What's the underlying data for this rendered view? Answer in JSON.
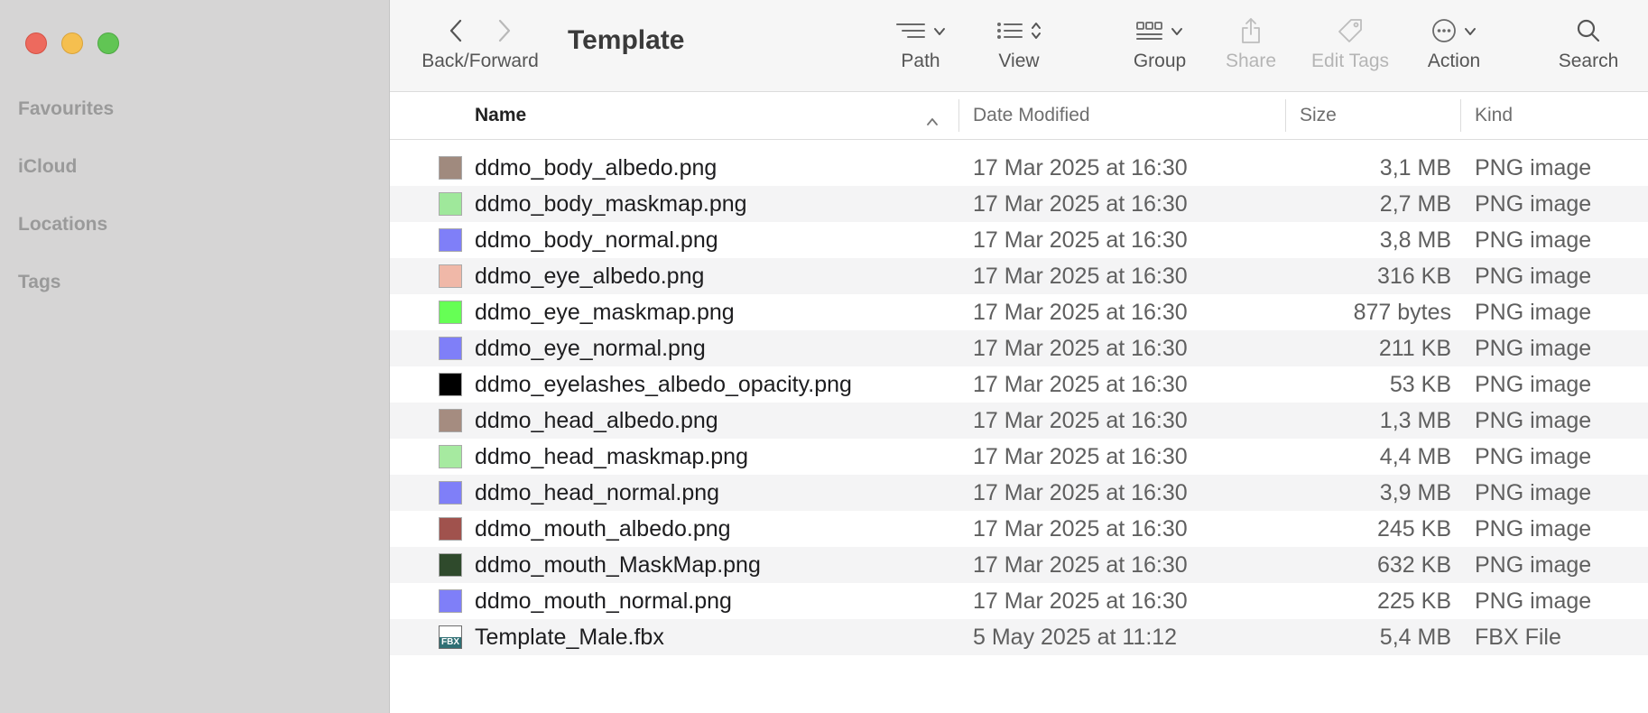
{
  "window": {
    "title": "Template"
  },
  "sidebar": {
    "sections": [
      "Favourites",
      "iCloud",
      "Locations",
      "Tags"
    ]
  },
  "toolbar": {
    "back_forward_label": "Back/Forward",
    "path_label": "Path",
    "view_label": "View",
    "group_label": "Group",
    "share_label": "Share",
    "edit_tags_label": "Edit Tags",
    "action_label": "Action",
    "search_label": "Search"
  },
  "columns": {
    "name": "Name",
    "date": "Date Modified",
    "size": "Size",
    "kind": "Kind"
  },
  "files": [
    {
      "name": "ddmo_body_albedo.png",
      "date": "17 Mar 2025 at 16:30",
      "size": "3,1 MB",
      "kind": "PNG image",
      "icon_color": "#a08a7e"
    },
    {
      "name": "ddmo_body_maskmap.png",
      "date": "17 Mar 2025 at 16:30",
      "size": "2,7 MB",
      "kind": "PNG image",
      "icon_color": "#9fe89b"
    },
    {
      "name": "ddmo_body_normal.png",
      "date": "17 Mar 2025 at 16:30",
      "size": "3,8 MB",
      "kind": "PNG image",
      "icon_color": "#7f7ff8"
    },
    {
      "name": "ddmo_eye_albedo.png",
      "date": "17 Mar 2025 at 16:30",
      "size": "316 KB",
      "kind": "PNG image",
      "icon_color": "#f0b8a8"
    },
    {
      "name": "ddmo_eye_maskmap.png",
      "date": "17 Mar 2025 at 16:30",
      "size": "877 bytes",
      "kind": "PNG image",
      "icon_color": "#66ff55"
    },
    {
      "name": "ddmo_eye_normal.png",
      "date": "17 Mar 2025 at 16:30",
      "size": "211 KB",
      "kind": "PNG image",
      "icon_color": "#7f7ff8"
    },
    {
      "name": "ddmo_eyelashes_albedo_opacity.png",
      "date": "17 Mar 2025 at 16:30",
      "size": "53 KB",
      "kind": "PNG image",
      "icon_color": "#000000"
    },
    {
      "name": "ddmo_head_albedo.png",
      "date": "17 Mar 2025 at 16:30",
      "size": "1,3 MB",
      "kind": "PNG image",
      "icon_color": "#a58c80"
    },
    {
      "name": "ddmo_head_maskmap.png",
      "date": "17 Mar 2025 at 16:30",
      "size": "4,4 MB",
      "kind": "PNG image",
      "icon_color": "#a6eaa0"
    },
    {
      "name": "ddmo_head_normal.png",
      "date": "17 Mar 2025 at 16:30",
      "size": "3,9 MB",
      "kind": "PNG image",
      "icon_color": "#7f7ff8"
    },
    {
      "name": "ddmo_mouth_albedo.png",
      "date": "17 Mar 2025 at 16:30",
      "size": "245 KB",
      "kind": "PNG image",
      "icon_color": "#a0524d"
    },
    {
      "name": "ddmo_mouth_MaskMap.png",
      "date": "17 Mar 2025 at 16:30",
      "size": "632 KB",
      "kind": "PNG image",
      "icon_color": "#2f4a2c"
    },
    {
      "name": "ddmo_mouth_normal.png",
      "date": "17 Mar 2025 at 16:30",
      "size": "225 KB",
      "kind": "PNG image",
      "icon_color": "#7f7ff8"
    },
    {
      "name": "Template_Male.fbx",
      "date": "5 May 2025 at 11:12",
      "size": "5,4 MB",
      "kind": "FBX File",
      "icon_color": "#2f6f74",
      "icon_text": "FBX"
    }
  ]
}
